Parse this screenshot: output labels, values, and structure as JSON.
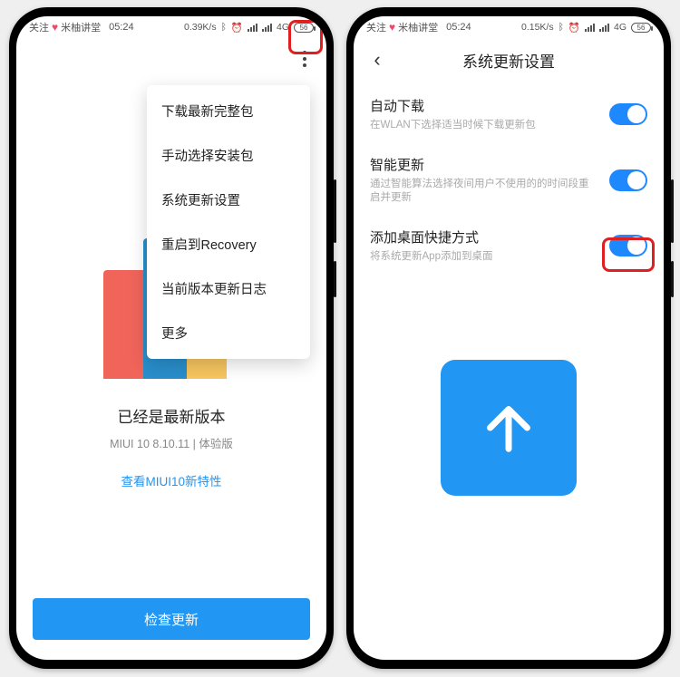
{
  "statusbar": {
    "badge_prefix": "关注",
    "badge_text": "米柚讲堂",
    "time": "05:24",
    "net_speed_a": "0.39K/s",
    "net_speed_b": "0.15K/s",
    "net_type": "4G",
    "battery": "56"
  },
  "screenA": {
    "menu": [
      "下载最新完整包",
      "手动选择安装包",
      "系统更新设置",
      "重启到Recovery",
      "当前版本更新日志",
      "更多"
    ],
    "version_title": "已经是最新版本",
    "version_sub": "MIUI 10 8.10.11 | 体验版",
    "link": "查看MIUI10新特性",
    "check_btn": "检查更新"
  },
  "screenB": {
    "title": "系统更新设置",
    "rows": [
      {
        "t": "自动下载",
        "d": "在WLAN下选择适当时候下载更新包",
        "on": true
      },
      {
        "t": "智能更新",
        "d": "通过智能算法选择夜间用户不使用的的时间段重启并更新",
        "on": true
      },
      {
        "t": "添加桌面快捷方式",
        "d": "将系统更新App添加到桌面",
        "on": true
      }
    ]
  }
}
